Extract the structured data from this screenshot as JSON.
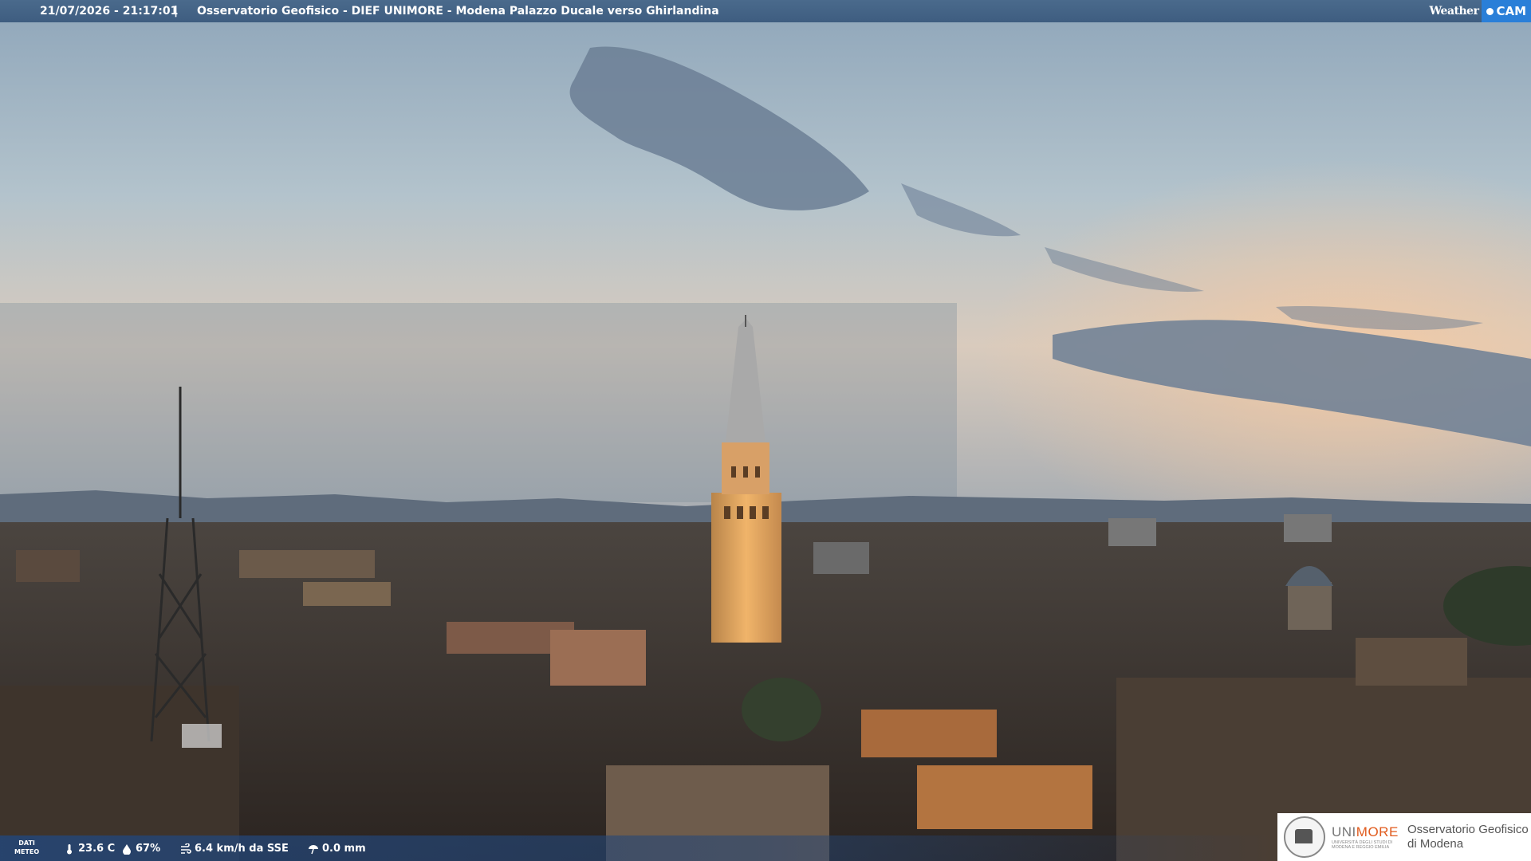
{
  "header": {
    "datetime": "21/07/2026 - 21:17:01",
    "separator": "|",
    "title": "Osservatorio Geofisico - DIEF UNIMORE - Modena Palazzo Ducale verso Ghirlandina"
  },
  "brand": {
    "weather": "Weather",
    "cam": "CAM"
  },
  "meteo": {
    "label_line1": "DATI",
    "label_line2": "METEO",
    "temperature": "23.6 C",
    "humidity": "67%",
    "wind": "6.4 km/h da SSE",
    "rain": "0.0 mm"
  },
  "logo": {
    "uni_prefix": "UNI",
    "uni_suffix": "MORE",
    "uni_sub": "UNIVERSITÀ DEGLI STUDI DI MODENA E REGGIO EMILIA",
    "observatory_line1": "Osservatorio Geofisico",
    "observatory_line2": "di Modena"
  },
  "colors": {
    "sky_top": "#9fb4c6",
    "sky_horizon": "#f3c8a0",
    "city": "#3a3028",
    "tower_lit": "#e2a35a",
    "bar": "#3e5d80",
    "brand_blue": "#2a7fd8",
    "unimore_orange": "#e05a1c"
  },
  "icons": [
    "thermometer-icon",
    "droplet-icon",
    "wind-icon",
    "rain-gauge-icon",
    "weathercam-logo-icon",
    "unimore-seal-icon"
  ]
}
